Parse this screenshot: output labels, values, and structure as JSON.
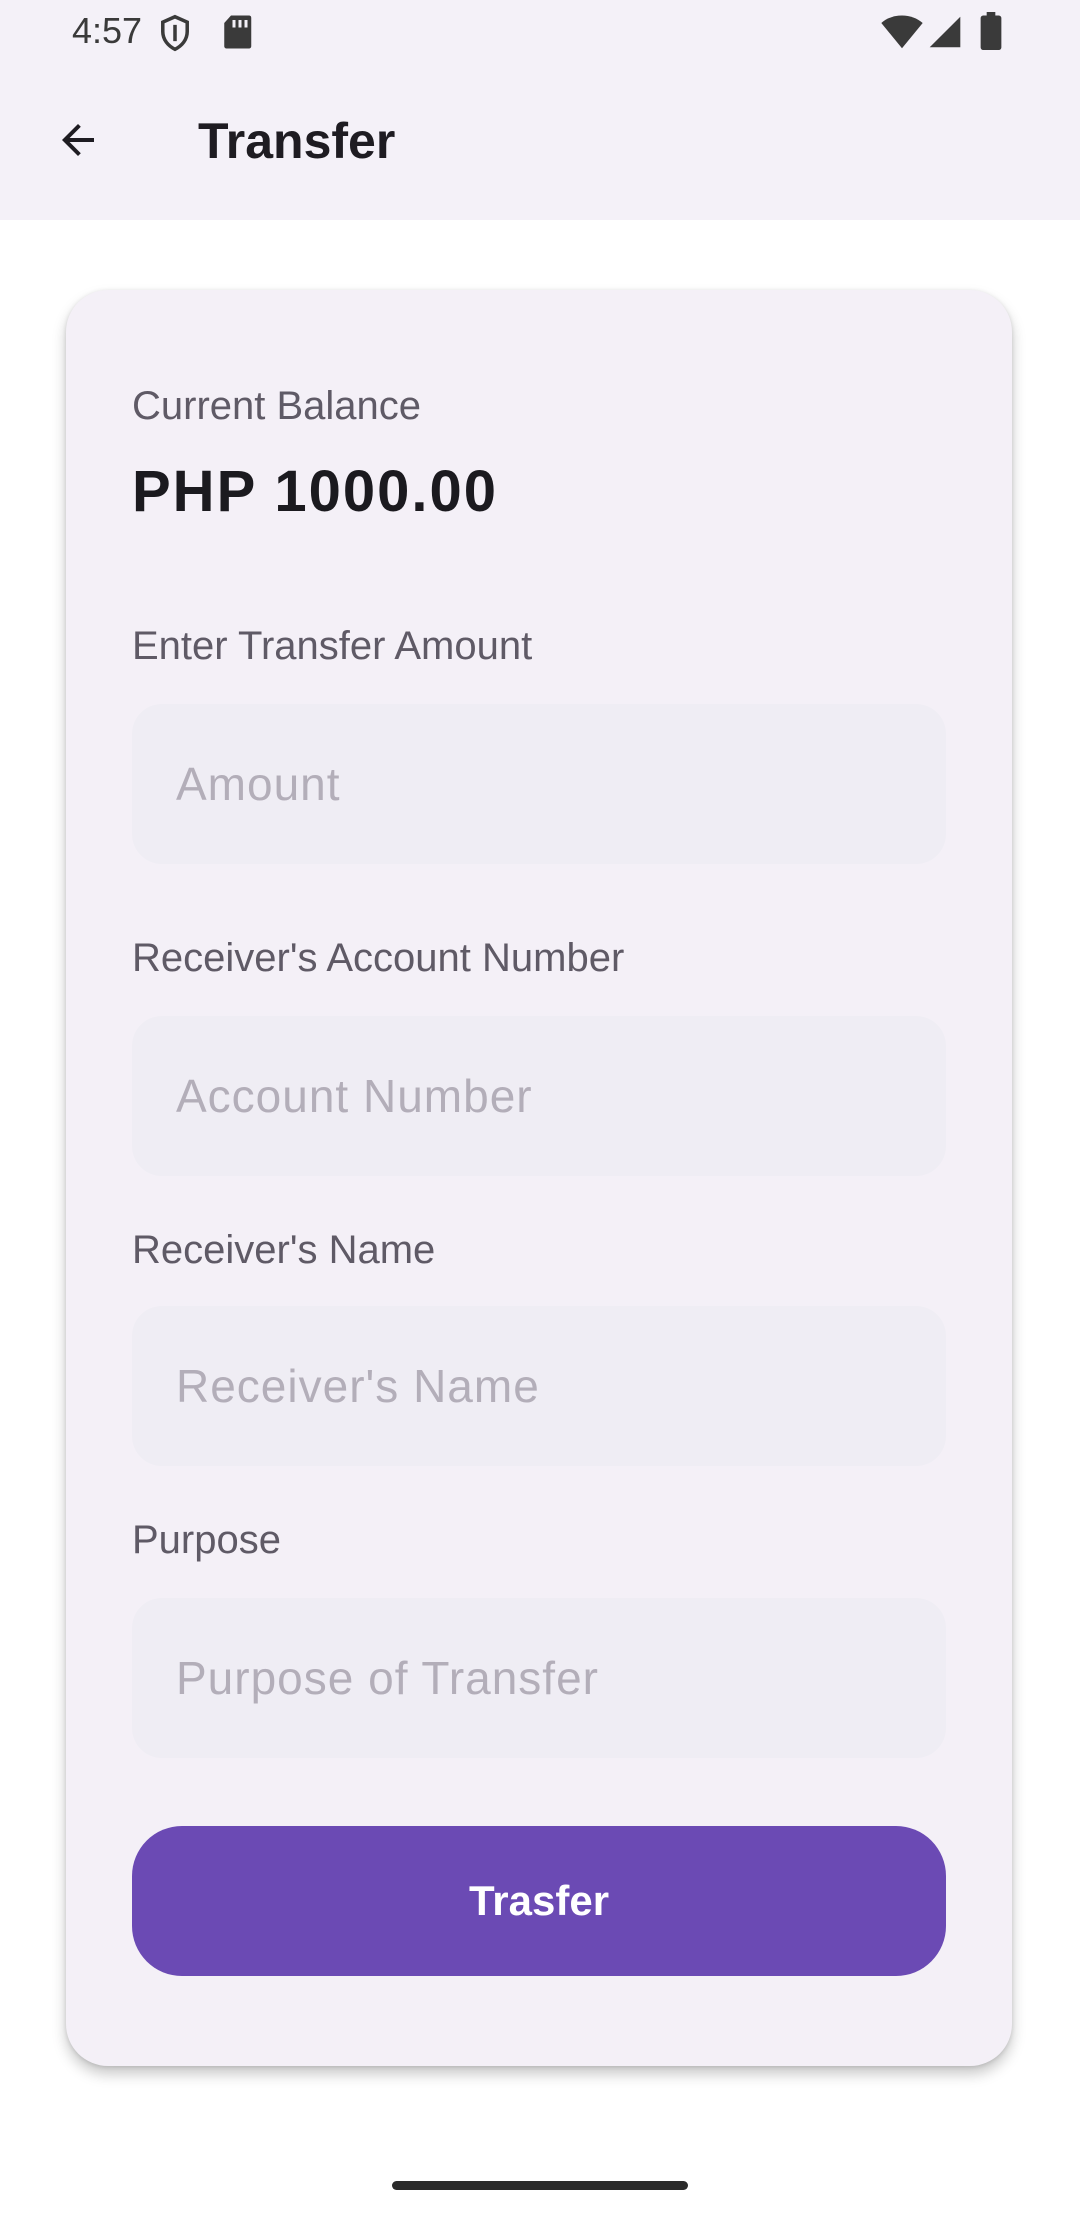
{
  "status_bar": {
    "time": "4:57",
    "left_icons": [
      "shield-icon",
      "sd-card-icon"
    ],
    "right_icons": [
      "wifi-icon",
      "cellular-signal-icon",
      "battery-icon"
    ]
  },
  "app_bar": {
    "back_icon": "arrow-back-icon",
    "title": "Transfer"
  },
  "balance": {
    "label": "Current Balance",
    "value": "PHP 1000.00"
  },
  "form": {
    "amount": {
      "label": "Enter Transfer Amount",
      "placeholder": "Amount",
      "value": ""
    },
    "account_number": {
      "label": "Receiver's Account Number",
      "placeholder": "Account Number",
      "value": ""
    },
    "receiver_name": {
      "label": "Receiver's Name",
      "placeholder": "Receiver's Name",
      "value": ""
    },
    "purpose": {
      "label": "Purpose",
      "placeholder": "Purpose of Transfer",
      "value": ""
    },
    "submit_label": "Trasfer"
  },
  "colors": {
    "accent": "#6b4ab4",
    "card_background": "#f4f0f7",
    "input_background": "#efedf4",
    "app_bar_background": "#f4f1f8"
  }
}
